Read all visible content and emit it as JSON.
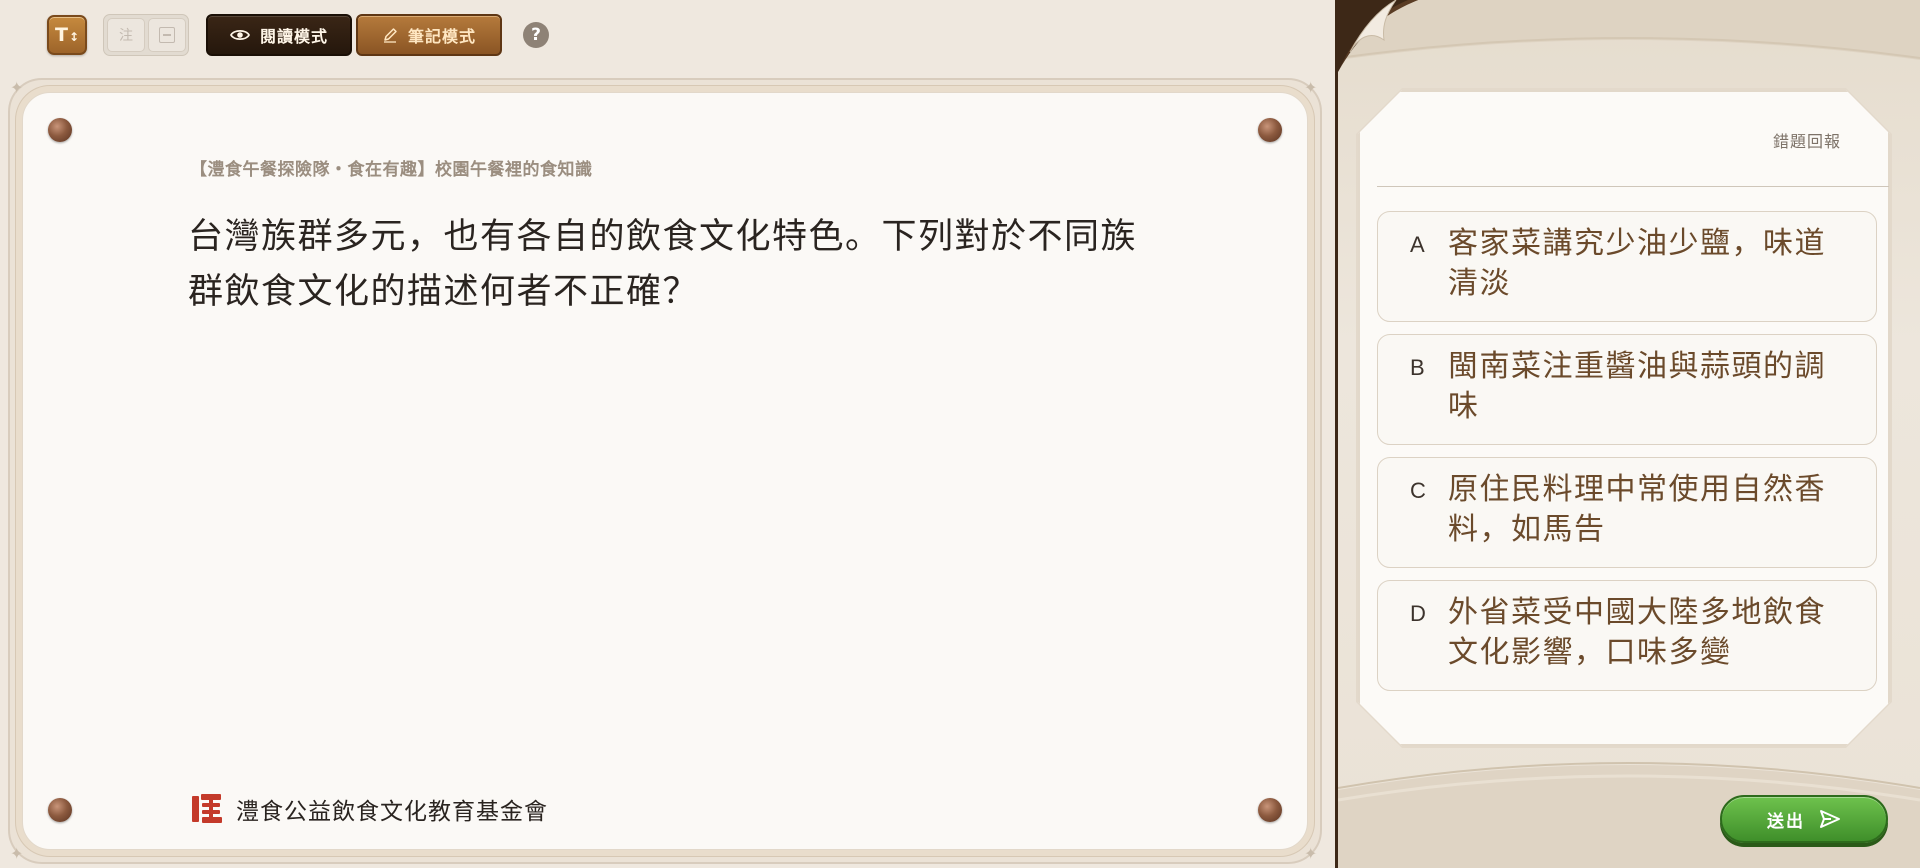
{
  "toolbar": {
    "font_size_label": "T",
    "font_size_arrows": "↕",
    "note_label": "注",
    "read_mode_label": "閱讀模式",
    "note_mode_label": "筆記模式",
    "help_label": "?"
  },
  "question": {
    "source": "【澧食午餐探險隊・食在有趣】校園午餐裡的食知識",
    "text": "台灣族群多元，也有各自的飲食文化特色。下列對於不同族群飲食文化的描述何者不正確？"
  },
  "footer": {
    "foundation_name": "澧食公益飲食文化教育基金會"
  },
  "panel": {
    "report_label": "錯題回報",
    "submit_label": "送出"
  },
  "options": [
    {
      "letter": "A",
      "text": "客家菜講究少油少鹽，味道清淡"
    },
    {
      "letter": "B",
      "text": "閩南菜注重醬油與蒜頭的調味"
    },
    {
      "letter": "C",
      "text": "原住民料理中常使用自然香料，如馬告"
    },
    {
      "letter": "D",
      "text": "外省菜受中國大陸多地飲食文化影響，口味多變"
    }
  ],
  "icons": {
    "font_size": "font-size-icon",
    "read_mode": "eye-icon",
    "note_mode": "pencil-icon",
    "help": "help-icon",
    "submit": "send-icon"
  },
  "colors": {
    "accent_brown": "#9d642a",
    "dark_brown": "#25170c",
    "text_brown": "#6b4a2b",
    "submit_green": "#4fa336",
    "logo_red": "#c43a2a"
  }
}
